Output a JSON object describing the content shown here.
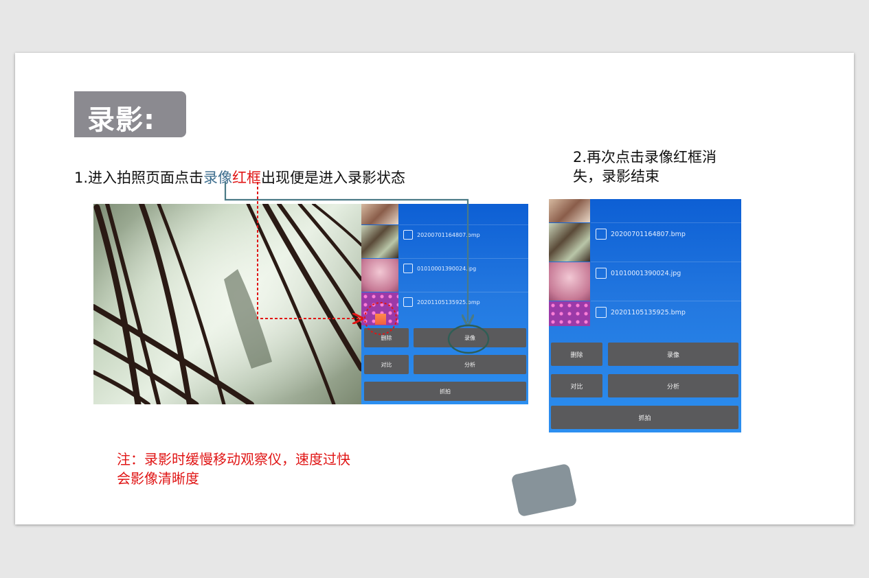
{
  "title": "录影:",
  "step1": {
    "prefix": "1.进入拍照页面点击",
    "blue_word": "录像",
    "red_word": "红框",
    "suffix": "出现便是进入录影状态"
  },
  "step2": {
    "line1": "2.再次点击录像红框消",
    "line2": "失，录影结束"
  },
  "note": {
    "line1": "注：录影时缓慢移动观察仪，速度过快",
    "line2": "会影像清晰度"
  },
  "screenshot1": {
    "files": [
      "20200701164807.bmp",
      "01010001390024.jpg",
      "20201105135925.bmp"
    ],
    "buttons": {
      "delete": "删除",
      "record": "录像",
      "compare": "对比",
      "analyze": "分析",
      "capture": "抓拍"
    }
  },
  "screenshot2": {
    "files": [
      "20200701164807.bmp",
      "01010001390024.jpg",
      "20201105135925.bmp"
    ],
    "buttons": {
      "delete": "删除",
      "record": "录像",
      "compare": "对比",
      "analyze": "分析",
      "capture": "抓拍"
    }
  },
  "colors": {
    "badge": "#8b8a90",
    "highlight_blue": "#3f6f8f",
    "highlight_red": "#e01515",
    "arrow": "#4a7a86",
    "panel_blue": "#2378e0",
    "button_gray": "#5a5a5c"
  }
}
